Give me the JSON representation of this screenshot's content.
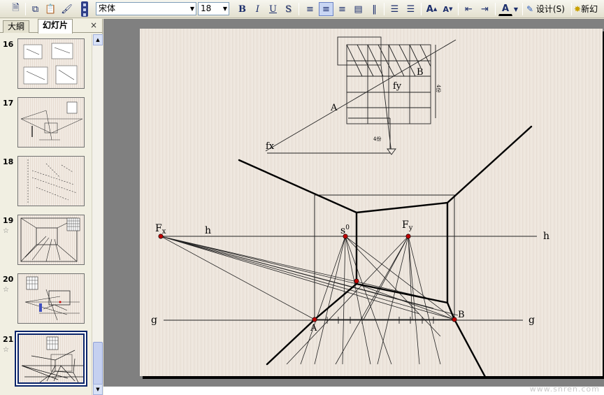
{
  "toolbar": {
    "font_name": "宋体",
    "font_size": "18",
    "bold_label": "B",
    "italic_label": "I",
    "underline_label": "U",
    "shadow_label": "S",
    "grow_font_label": "A",
    "shrink_font_label": "A",
    "font_color_label": "A",
    "design_label": "设计(S)",
    "new_slide_label": "新幻"
  },
  "pane": {
    "tab_outline": "大綱",
    "tab_slides": "幻灯片",
    "close_glyph": "×"
  },
  "slides": [
    {
      "number": "16",
      "star": ""
    },
    {
      "number": "17",
      "star": ""
    },
    {
      "number": "18",
      "star": ""
    },
    {
      "number": "19",
      "star": "☆"
    },
    {
      "number": "20",
      "star": "☆"
    },
    {
      "number": "21",
      "star": "☆"
    }
  ],
  "drawing": {
    "label_A_top": "A",
    "label_B_top": "B",
    "label_fy": "fy",
    "label_fx": "fx",
    "label_dim_right": "4份",
    "label_dim_bottom": "4份",
    "label_Fx": "F",
    "label_Fx_sub": "x",
    "label_h_left": "h",
    "label_h_right": "h",
    "label_s0": "s",
    "label_s0_sup": "0",
    "label_Fy": "F",
    "label_Fy_sub": "y",
    "label_g_left": "g",
    "label_g_right": "g",
    "label_A_bottom": "A",
    "label_B_bottom": "B"
  },
  "watermark": "www.snren.com",
  "colors": {
    "selection": "#0a246a",
    "point_red": "#c00000"
  },
  "icons": [
    "new-icon",
    "copy-icon",
    "paste-icon",
    "format-painter-icon",
    "align-left-icon",
    "align-center-icon",
    "align-right-icon",
    "justify-icon",
    "distribute-icon",
    "numbering-icon",
    "bullets-icon",
    "grow-font-icon",
    "shrink-font-icon",
    "decrease-indent-icon",
    "increase-indent-icon",
    "font-color-icon",
    "design-icon",
    "new-slide-icon"
  ]
}
